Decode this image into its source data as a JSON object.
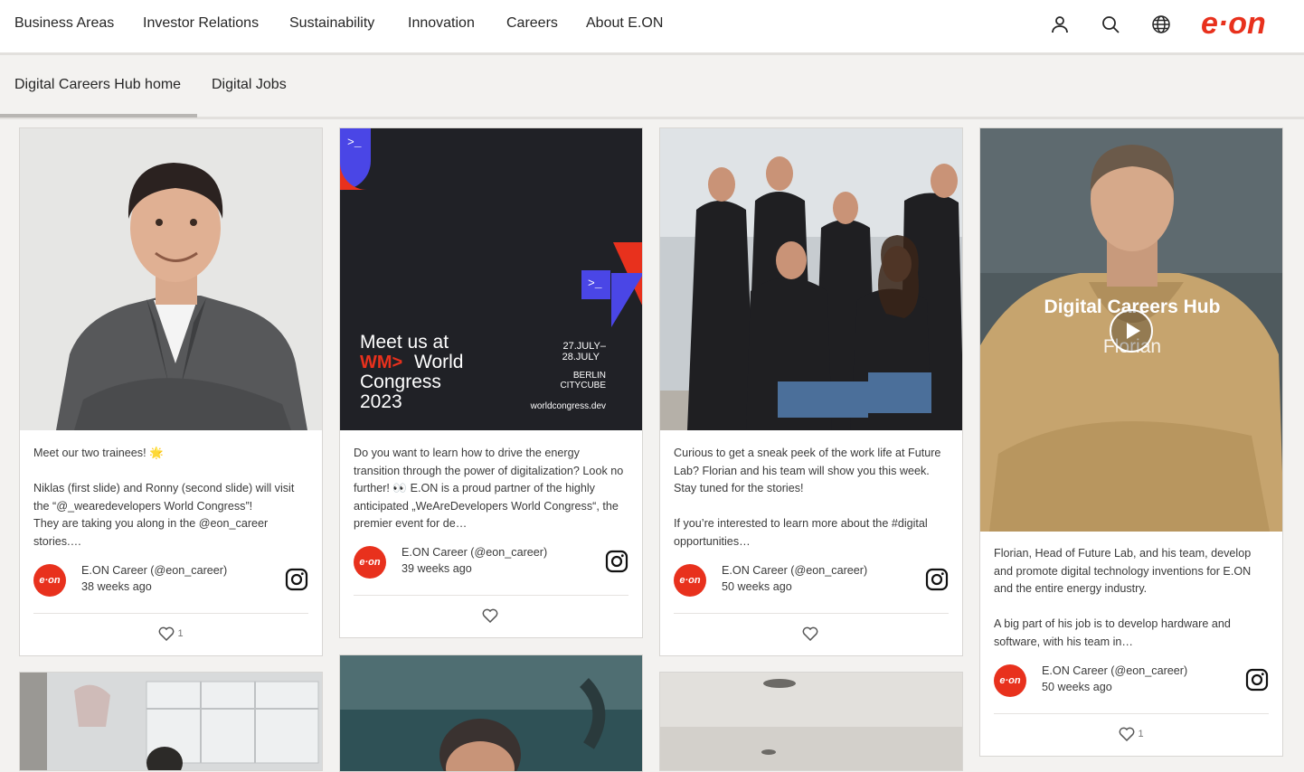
{
  "nav": {
    "items": [
      "Business Areas",
      "Investor Relations",
      "Sustainability",
      "Innovation",
      "Careers",
      "About E.ON"
    ],
    "logo_text": "e·on"
  },
  "subnav": {
    "items": [
      "Digital Careers Hub home",
      "Digital Jobs"
    ]
  },
  "colors": {
    "brand": "#e8311d",
    "text": "#262626",
    "bg": "#f3f2f0",
    "card_border": "#d8d6d3"
  },
  "cards": [
    {
      "caption": "Meet our two trainees! 🌟\n\nNiklas (first slide) and Ronny (second slide) will visit the “@_wearedevelopers World Congress”!\nThey are taking you along in the @eon_career stories.…",
      "author": "E.ON Career (@eon_career)",
      "time": "38 weeks ago",
      "likes": "1",
      "avatar_text": "e·on"
    },
    {
      "caption": "Do you want to learn how to drive the energy transition through the power of digitalization? Look no further! 👀 E.ON is a proud partner of the highly anticipated „WeAreDevelopers World Congress“, the premier event for de…",
      "author": "E.ON Career (@eon_career)",
      "time": "39 weeks ago",
      "likes": "",
      "avatar_text": "e·on",
      "poster": {
        "heading_1": "Meet us at",
        "logo_mark": "WM>",
        "heading_2": "World",
        "heading_3": "Congress",
        "year": "2023",
        "date_1": "27.JULY–",
        "date_2": "28.JULY",
        "city": "BERLIN",
        "venue": "CITYCUBE",
        "url": "worldcongress.dev",
        "prompt": ">_"
      }
    },
    {
      "caption": "Curious to get a sneak peek of the work life at Future Lab? Florian and his team will show you this week. Stay tuned for the stories!\n\nIf you’re interested to learn more about the #digital opportunities…",
      "author": "E.ON Career (@eon_career)",
      "time": "50 weeks ago",
      "likes": "",
      "avatar_text": "e·on"
    },
    {
      "caption": "Florian, Head of Future Lab, and his team, develop and promote digital technology inventions for E.ON and the entire energy industry.\n\nA big part of his job is to develop hardware and software, with his team in…",
      "author": "E.ON Career (@eon_career)",
      "time": "50 weeks ago",
      "likes": "1",
      "avatar_text": "e·on",
      "video": {
        "title": "Digital Careers Hub",
        "subtitle": "Florian"
      }
    }
  ]
}
